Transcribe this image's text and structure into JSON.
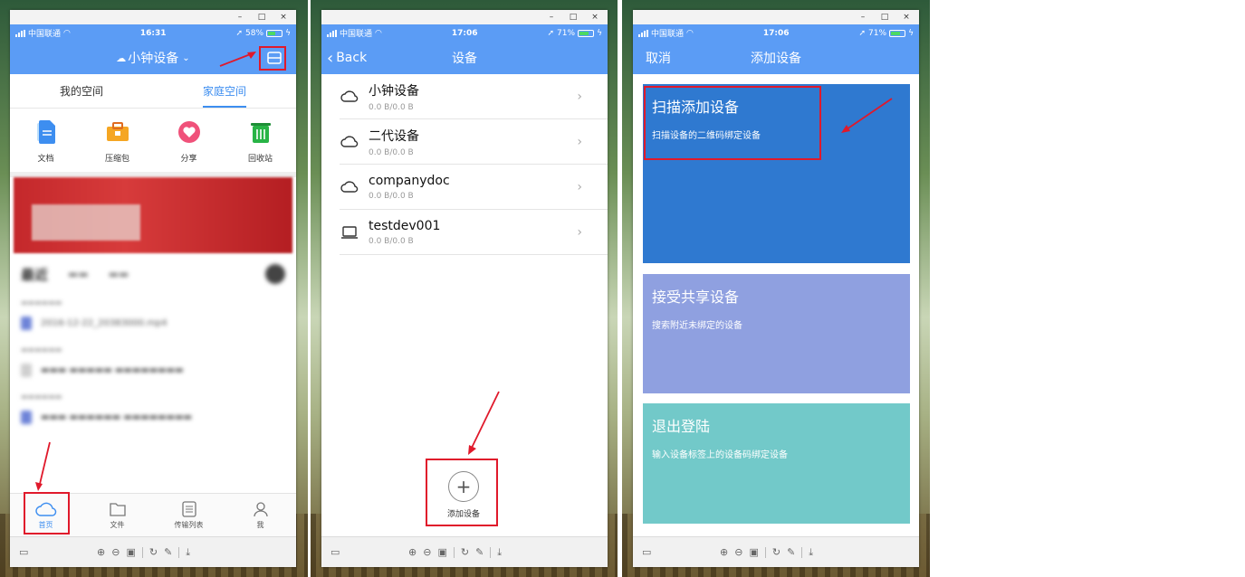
{
  "status": {
    "carrier": "中国联通",
    "screen1_time": "16:31",
    "screen1_battery": "58%",
    "screen1_battery_level": 0.58,
    "screen2_time": "17:06",
    "screen2_battery": "71%",
    "screen2_battery_level": 0.71,
    "screen3_time": "17:06",
    "screen3_battery": "71%",
    "screen3_battery_level": 0.71
  },
  "screen1": {
    "device_title": "小钟设备",
    "tabs": [
      "我的空间",
      "家庭空间"
    ],
    "shortcuts": [
      {
        "label": "文档",
        "icon": "document-icon"
      },
      {
        "label": "压缩包",
        "icon": "archive-icon"
      },
      {
        "label": "分享",
        "icon": "share-heart-icon"
      },
      {
        "label": "回收站",
        "icon": "recycle-bin-icon"
      }
    ],
    "tabbar": [
      {
        "label": "首页",
        "icon": "cloud-icon"
      },
      {
        "label": "文件",
        "icon": "folder-icon"
      },
      {
        "label": "传输列表",
        "icon": "transfer-list-icon"
      },
      {
        "label": "我",
        "icon": "person-icon"
      }
    ],
    "recent_tab": "最近",
    "blurred_file": "2016-12-22_20383000.mp4"
  },
  "screen2": {
    "back": "Back",
    "title": "设备",
    "devices": [
      {
        "name": "小钟设备",
        "size": "0.0 B/0.0 B",
        "icon": "cloud-icon"
      },
      {
        "name": "二代设备",
        "size": "0.0 B/0.0 B",
        "icon": "cloud-icon"
      },
      {
        "name": "companydoc",
        "size": "0.0 B/0.0 B",
        "icon": "cloud-icon"
      },
      {
        "name": "testdev001",
        "size": "0.0 B/0.0 B",
        "icon": "laptop-icon"
      }
    ],
    "add_label": "添加设备",
    "add_symbol": "+"
  },
  "screen3": {
    "cancel": "取消",
    "title": "添加设备",
    "cards": [
      {
        "title": "扫描添加设备",
        "desc": "扫描设备的二维码绑定设备"
      },
      {
        "title": "接受共享设备",
        "desc": "搜索附近未绑定的设备"
      },
      {
        "title": "退出登陆",
        "desc": "输入设备标签上的设备码绑定设备"
      }
    ]
  },
  "colors": {
    "header_blue": "#5b9cf5",
    "accent_blue": "#3d8ef0",
    "annotation_red": "#e0192b",
    "card1": "#2f79d0",
    "card2": "#8fa0e0",
    "card3": "#72c9c9"
  }
}
